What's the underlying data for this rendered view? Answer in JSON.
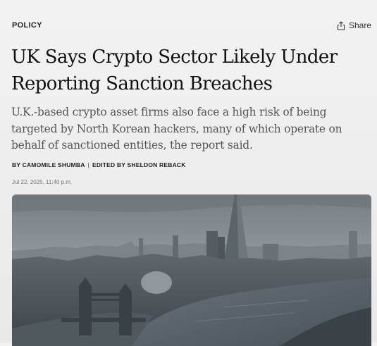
{
  "article": {
    "category": "POLICY",
    "share_label": "Share",
    "headline_line1": "UK Says Crypto Sector Likely Under",
    "headline_line2": "Reporting Sanction Breaches",
    "dek": "U.K.-based crypto asset firms also face a high risk of being targeted by North Korean hackers, many of which operate on behalf of sanctioned entities, the report said.",
    "byline_author": "BY CAMOMILE SHUMBA",
    "byline_separator": "|",
    "byline_editor": "EDITED BY SHELDON REBACK",
    "timestamp": "Jul 22, 2025, 11:40 p.m."
  },
  "hero_image": {
    "subject": "London skyline aerial view with The Shard and Tower Bridge",
    "sky_color": "#8a9095",
    "river_color": "#4f5a60"
  },
  "icons": {
    "share": "share-icon"
  }
}
